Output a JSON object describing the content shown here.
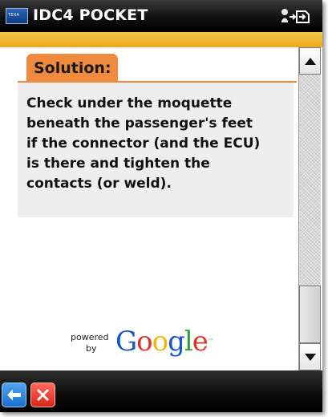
{
  "window": {
    "title": "IDC4 POCKET",
    "app_icon_text": "TEXA",
    "connection_icon": "sync-connection-icon"
  },
  "content": {
    "section_label": "Solution:",
    "solution_text": "Check under the moquette\nbeneath the passenger's feet\nif the connector (and the ECU)\nis there and tighten the\ncontacts (or weld).",
    "powered_by": {
      "powered": "powered",
      "by": "by",
      "brand": "Google"
    }
  },
  "scrollbar": {
    "up_icon": "arrow-up-icon",
    "down_icon": "arrow-down-icon"
  },
  "toolbar": {
    "back_icon": "back-arrow-icon",
    "close_icon": "close-x-icon"
  },
  "colors": {
    "accent_orange": "#f08a3e",
    "accent_bar": "#f2b631",
    "title_bar": "#000000",
    "solution_background": "#eeeeee"
  }
}
